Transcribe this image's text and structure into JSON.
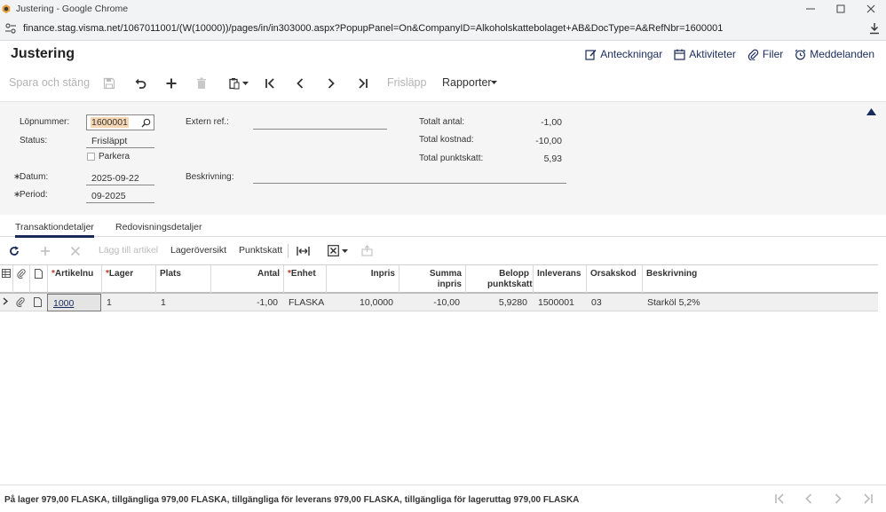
{
  "browser": {
    "window_title": "Justering - Google Chrome",
    "url": "finance.stag.visma.net/1067011001/(W(10000))/pages/in/in303000.aspx?PopupPanel=On&CompanyID=Alkoholskattebolaget+AB&DocType=A&RefNbr=1600001"
  },
  "header": {
    "title": "Justering",
    "links": [
      "Anteckningar",
      "Aktiviteter",
      "Filer",
      "Meddelanden"
    ]
  },
  "toolbar": {
    "save_close": "Spara och stäng",
    "release": "Frisläpp",
    "reports": "Rapporter"
  },
  "form": {
    "ref_nbr_label": "Löpnummer:",
    "ref_nbr": "1600001",
    "status_label": "Status:",
    "status": "Frisläppt",
    "hold_label": "Parkera",
    "date_label": "Datum:",
    "date": "2025-09-22",
    "period_label": "Period:",
    "period": "09-2025",
    "ext_ref_label": "Extern ref.:",
    "ext_ref": "",
    "description_label": "Beskrivning:",
    "description": "",
    "total_qty_label": "Totalt antal:",
    "total_qty": "-1,00",
    "total_cost_label": "Total kostnad:",
    "total_cost": "-10,00",
    "total_excise_label": "Total punktskatt:",
    "total_excise": "5,93"
  },
  "tabs": [
    "Transaktiondetaljer",
    "Redovisningsdetaljer"
  ],
  "grid_toolbar": {
    "add_item": "Lägg till artikel",
    "inventory_summary": "Lageröversikt",
    "excise": "Punktskatt"
  },
  "grid": {
    "columns": [
      {
        "label": "Artikelnu",
        "required": true
      },
      {
        "label": "Lager",
        "required": true
      },
      {
        "label": "Plats",
        "required": false
      },
      {
        "label": "Antal",
        "required": false
      },
      {
        "label": "Enhet",
        "required": true
      },
      {
        "label": "Inpris",
        "required": false
      },
      {
        "label": "Summa inpris",
        "required": false
      },
      {
        "label": "Belopp punktskatt",
        "required": false
      },
      {
        "label": "Inleverans",
        "required": false
      },
      {
        "label": "Orsakskod",
        "required": false
      },
      {
        "label": "Beskrivning",
        "required": false
      }
    ],
    "rows": [
      [
        "1000",
        "1",
        "1",
        "-1,00",
        "FLASKA",
        "10,0000",
        "-10,00",
        "5,9280",
        "1500001",
        "03",
        "Starköl 5,2%"
      ]
    ]
  },
  "footer": {
    "status": "På lager 979,00 FLASKA, tillgängliga 979,00 FLASKA, tillgängliga för leverans 979,00 FLASKA, tillgängliga för lageruttag 979,00 FLASKA"
  }
}
